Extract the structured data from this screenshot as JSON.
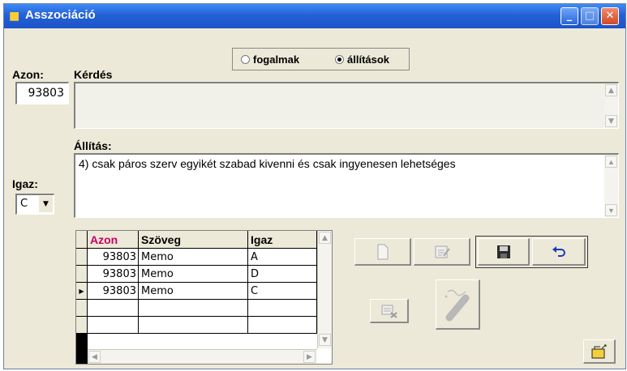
{
  "window": {
    "title": "Asszociáció"
  },
  "labels": {
    "azon": "Azon:",
    "kerdes": "Kérdés",
    "allitas": "Állítás:",
    "igaz": "Igaz:"
  },
  "azon_value": "93803",
  "kerdes_text": "",
  "allitas_text": "4) csak páros szerv egyikét szabad kivenni és csak ingyenesen lehetséges",
  "igaz_value": "C",
  "mode": {
    "options": [
      {
        "label": "fogalmak",
        "selected": false
      },
      {
        "label": "állítások",
        "selected": true
      }
    ]
  },
  "grid": {
    "headers": [
      "Azon",
      "Szöveg",
      "Igaz"
    ],
    "rows": [
      {
        "azon": "93803",
        "szoveg": "Memo",
        "igaz": "A"
      },
      {
        "azon": "93803",
        "szoveg": "Memo",
        "igaz": "D"
      },
      {
        "azon": "93803",
        "szoveg": "Memo",
        "igaz": "C"
      }
    ],
    "current_row": 3
  },
  "colors": {
    "title_bar": "#2461d6",
    "azon_header": "#cc0066",
    "face": "#ece9d8"
  },
  "icons": [
    "new-record-icon",
    "edit-icon",
    "save-icon",
    "undo-icon",
    "delete-icon",
    "magic-wand-icon",
    "exit-icon"
  ]
}
